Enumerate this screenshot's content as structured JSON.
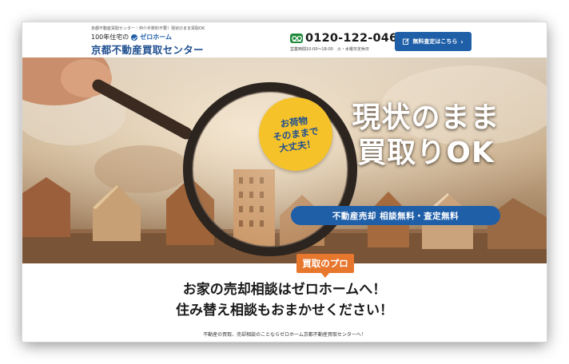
{
  "header": {
    "tagline": "京都不動産買取センター｜仲介手数料不要！現状のまま買取OK",
    "logo_prefix": "100年住宅の",
    "logo_brand": "ゼロホーム",
    "logo_main": "京都不動産買取センター",
    "phone_icon": "free-dial-icon",
    "phone": "0120-122-046",
    "hours": "営業時間10:00～18:00　火・水曜日定休日",
    "cta_label": "無料査定はこちら",
    "cta_arrow": "›"
  },
  "hero": {
    "badge_lines": [
      "お荷物",
      "そのままで",
      "大丈夫！"
    ],
    "headline_lines": [
      "現状のまま",
      "買取りOK"
    ],
    "service_bar": "不動産売却 相談無料・査定無料"
  },
  "content": {
    "tab_label": "買取のプロ",
    "heading_lines": [
      "お家の売却相談はゼロホームへ！",
      "住み替え相談もおまかせください！"
    ],
    "body_text": "不動産の買取、売却相談のことならゼロホーム京都不動産買取センターへ！"
  },
  "colors": {
    "brand_blue": "#1f5fa8",
    "accent_orange": "#e8772e",
    "badge_yellow": "#f6c22a",
    "phone_green": "#1f8a3a"
  }
}
